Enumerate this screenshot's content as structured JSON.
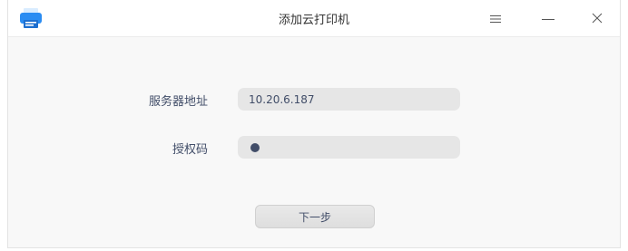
{
  "window": {
    "title": "添加云打印机",
    "icon": "printer-icon"
  },
  "titlebar_buttons": {
    "menu_icon": "hamburger-menu-icon",
    "minimize_icon": "minimize-icon",
    "close_icon": "close-icon"
  },
  "form": {
    "server_label": "服务器地址",
    "server_value": "10.20.6.187",
    "password_label": "授权码",
    "password_masked_chars": 1
  },
  "actions": {
    "next_label": "下一步"
  },
  "colors": {
    "accent": "#2a8cf2",
    "text": "#414d68",
    "field_bg": "#e6e6e6"
  }
}
